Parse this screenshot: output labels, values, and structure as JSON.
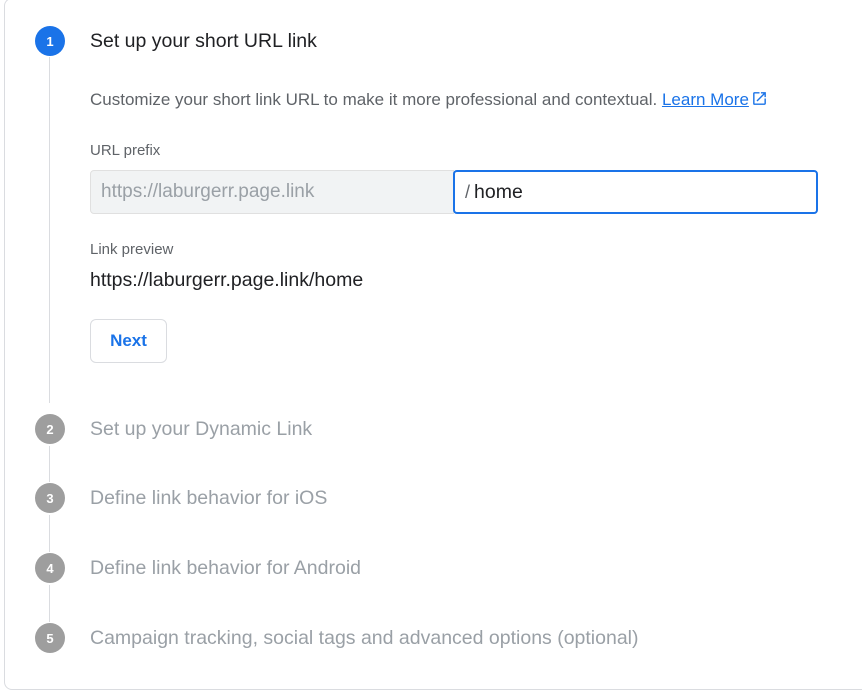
{
  "steps": [
    {
      "number": "1",
      "title": "Set up your short URL link"
    },
    {
      "number": "2",
      "title": "Set up your Dynamic Link"
    },
    {
      "number": "3",
      "title": "Define link behavior for iOS"
    },
    {
      "number": "4",
      "title": "Define link behavior for Android"
    },
    {
      "number": "5",
      "title": "Campaign tracking, social tags and advanced options (optional)"
    }
  ],
  "step1": {
    "description": "Customize your short link URL to make it more professional and contextual.",
    "learn_more": "Learn More",
    "url_prefix_label": "URL prefix",
    "url_prefix_value": "https://laburgerr.page.link",
    "slash": "/",
    "path_value": "home",
    "link_preview_label": "Link preview",
    "link_preview_value": "https://laburgerr.page.link/home",
    "next_button": "Next"
  },
  "icons": {
    "learn_more": "open-in-new-icon"
  },
  "colors": {
    "accent": "#1a73e8",
    "inactive_step": "#9e9e9e",
    "inactive_text": "#9aa0a6"
  }
}
